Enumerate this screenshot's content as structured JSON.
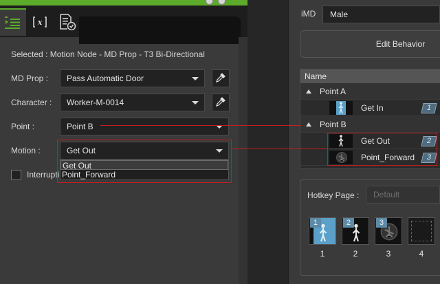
{
  "left_panel": {
    "tabs": [
      {
        "icon": "list-icon",
        "active": true
      },
      {
        "icon": "variable-x-icon",
        "active": false
      },
      {
        "icon": "checklist-icon",
        "active": false
      }
    ],
    "selected_text": "Selected : Motion Node - MD Prop - T3 Bi-Directional",
    "md_prop": {
      "label": "MD Prop :",
      "value": "Pass Automatic Door"
    },
    "character": {
      "label": "Character :",
      "value": "Worker-M-0014"
    },
    "point": {
      "label": "Point :",
      "value": "Point B"
    },
    "motion": {
      "label": "Motion :",
      "value": "Get Out",
      "options": [
        "Get Out",
        "Point_Forward"
      ]
    },
    "interrupt": {
      "label": "Interrupti",
      "checked": false
    }
  },
  "right_panel": {
    "imd_label": "iMD",
    "imd_value": "Male",
    "edit_behavior": "Edit Behavior",
    "tree": {
      "header": "Name",
      "groups": [
        {
          "name": "Point A",
          "items": [
            {
              "label": "Get In",
              "badge": "1"
            }
          ]
        },
        {
          "name": "Point B",
          "items": [
            {
              "label": "Get Out",
              "badge": "2"
            },
            {
              "label": "Point_Forward",
              "badge": "3"
            }
          ]
        }
      ]
    },
    "hotkey": {
      "label": "Hotkey Page :",
      "page_placeholder": "Default",
      "slots": [
        {
          "num": "1",
          "caption": "1"
        },
        {
          "num": "2",
          "caption": "2"
        },
        {
          "num": "3",
          "caption": "3"
        },
        {
          "num": "",
          "caption": "4"
        }
      ]
    }
  },
  "colors": {
    "accent_green": "#5cab2a",
    "annotation_red": "#c41e1e",
    "badge_blue": "#5d8aa6"
  }
}
